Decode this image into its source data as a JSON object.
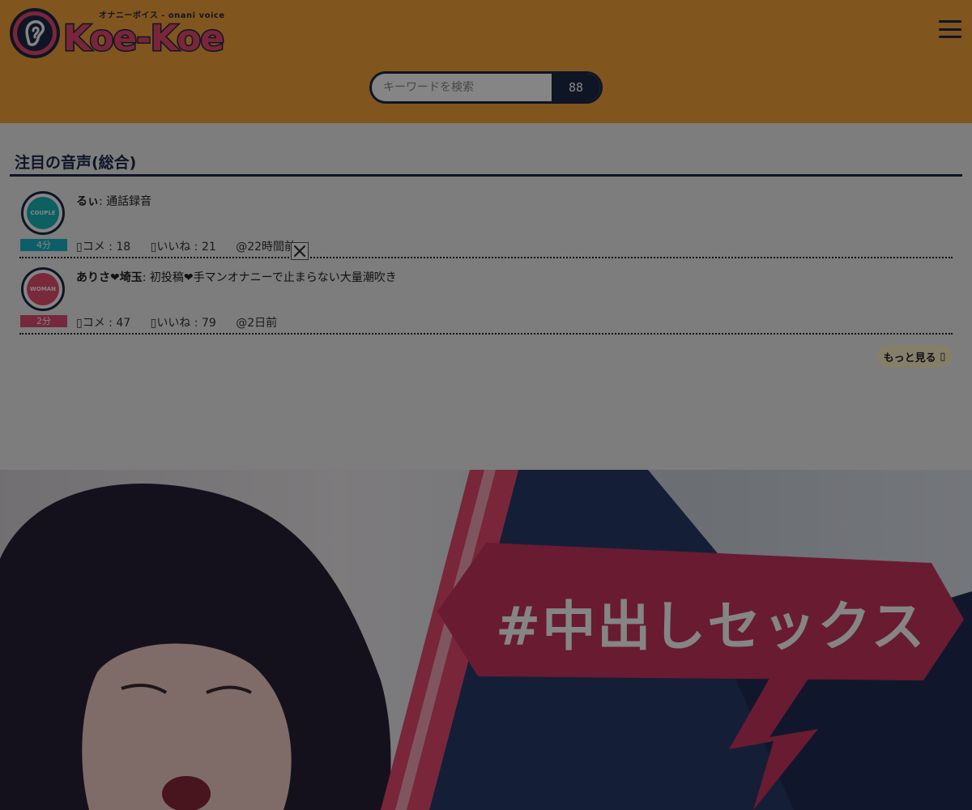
{
  "header": {
    "logo_text": "Koe-Koe",
    "logo_tagline": "オナニーボイス - onani voice",
    "search": {
      "placeholder": "キーワードを検索",
      "button_label": "88"
    }
  },
  "section": {
    "title": "注目の音声(総合)",
    "items": [
      {
        "author": "るぃ",
        "title": "通話録音",
        "duration": "4分",
        "duration_color": "#17b6c8",
        "avatar_label": "COUPLE",
        "avatar_color": "#19b7b8",
        "comments": "コメ : 18",
        "likes": "いいね : 21",
        "posted": "@22時間前"
      },
      {
        "author": "ありさ❤埼玉",
        "title": "初投稿❤手マンオナニーで止まらない大量潮吹き",
        "duration": "2分",
        "duration_color": "#e34d73",
        "avatar_label": "WOMAN",
        "avatar_color": "#e9506f",
        "comments": "コメ : 47",
        "likes": "いいね : 79",
        "posted": "@2日前"
      }
    ],
    "more_label": "もっと見る"
  },
  "banner": {
    "text": "#中出しセックス"
  },
  "colors": {
    "header_bg": "#f7a43a",
    "navy": "#1b2a47",
    "pink": "#e34d73",
    "teal": "#17b6c8"
  }
}
